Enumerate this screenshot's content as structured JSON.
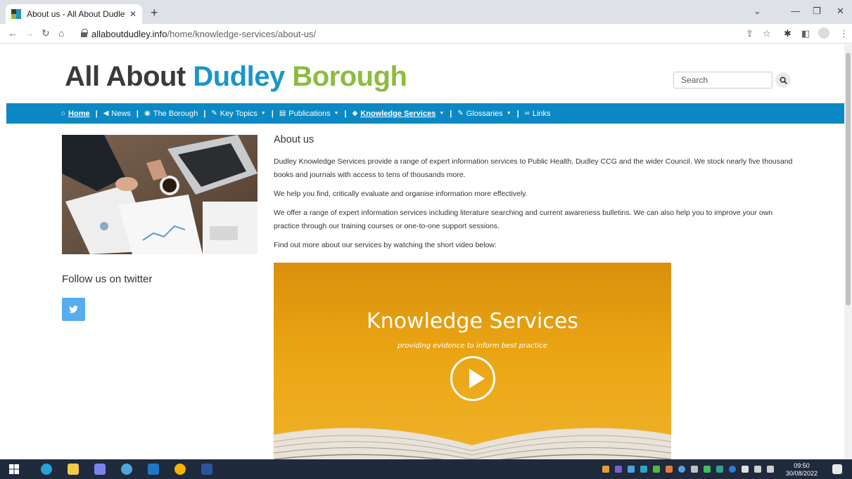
{
  "browser": {
    "tab_title": "About us - All About Dudley Boro",
    "url_host": "allaboutdudley.info",
    "url_path": "/home/knowledge-services/about-us/"
  },
  "site": {
    "title_part1": "All About",
    "title_part2": "Dudley",
    "title_part3": "Borough",
    "search_placeholder": "Search"
  },
  "nav": {
    "items": [
      {
        "label": "Home",
        "icon": "home-icon"
      },
      {
        "label": "News",
        "icon": "megaphone-icon"
      },
      {
        "label": "The Borough",
        "icon": "globe-icon"
      },
      {
        "label": "Key Topics",
        "icon": "wrench-icon"
      },
      {
        "label": "Publications",
        "icon": "book-icon"
      },
      {
        "label": "Knowledge Services",
        "icon": "graduation-cap-icon"
      },
      {
        "label": "Glossaries",
        "icon": "pencil-icon"
      },
      {
        "label": "Links",
        "icon": "link-icon"
      }
    ]
  },
  "sidebar": {
    "follow_label": "Follow us on twitter"
  },
  "content": {
    "heading": "About us",
    "p1": "Dudley Knowledge Services provide a range of expert information services to Public Health, Dudley CCG and the wider Council.  We stock nearly five thousand books and journals with access to tens of thousands more.",
    "p2": "We help you find, critically evaluate and organise information more effectively.",
    "p3": "We offer a range of expert information services including literature searching and current awareness bulletins.  We can also help you to improve your own practice through our training courses or one-to-one support sessions.",
    "p4": "Find out more about our services by watching the short video below:"
  },
  "video": {
    "title": "Knowledge Services",
    "subtitle": "providing evidence to inform best practice"
  },
  "taskbar": {
    "time": "09:50",
    "date": "30/08/2022"
  }
}
